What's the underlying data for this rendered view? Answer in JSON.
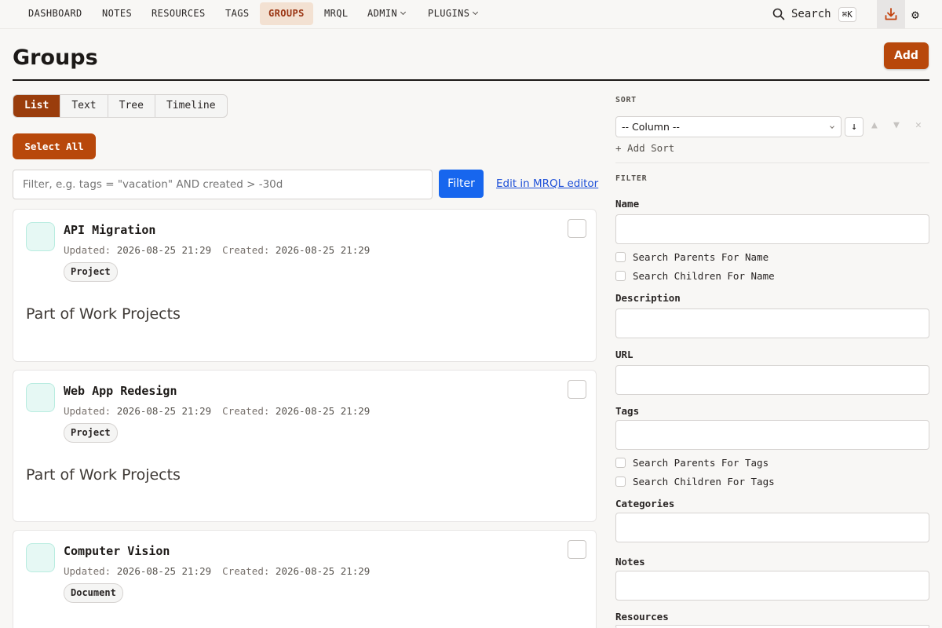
{
  "nav": {
    "items": [
      {
        "label": "DASHBOARD"
      },
      {
        "label": "NOTES"
      },
      {
        "label": "RESOURCES"
      },
      {
        "label": "TAGS"
      },
      {
        "label": "GROUPS",
        "active": true
      },
      {
        "label": "MRQL"
      },
      {
        "label": "ADMIN",
        "dropdown": true
      },
      {
        "label": "PLUGINS",
        "dropdown": true
      }
    ],
    "search_label": "Search",
    "search_shortcut": "⌘K"
  },
  "header": {
    "title": "Groups",
    "add_label": "Add"
  },
  "view_tabs": [
    {
      "label": "List",
      "active": true
    },
    {
      "label": "Text"
    },
    {
      "label": "Tree"
    },
    {
      "label": "Timeline"
    }
  ],
  "select_all_label": "Select All",
  "filter_bar": {
    "placeholder": "Filter, e.g. tags = \"vacation\" AND created > -30d",
    "button_label": "Filter",
    "mrql_link_label": "Edit in MRQL editor"
  },
  "groups": [
    {
      "name": "API Migration",
      "updated_label": "Updated:",
      "updated": "2026-08-25 21:29",
      "created_label": "Created:",
      "created": "2026-08-25 21:29",
      "tag": "Project",
      "description": "Part of Work Projects"
    },
    {
      "name": "Web App Redesign",
      "updated_label": "Updated:",
      "updated": "2026-08-25 21:29",
      "created_label": "Created:",
      "created": "2026-08-25 21:29",
      "tag": "Project",
      "description": "Part of Work Projects"
    },
    {
      "name": "Computer Vision",
      "updated_label": "Updated:",
      "updated": "2026-08-25 21:29",
      "created_label": "Created:",
      "created": "2026-08-25 21:29",
      "tag": "Document",
      "description": ""
    }
  ],
  "sidebar": {
    "sort_heading": "SORT",
    "sort_column": "-- Column --",
    "sort_direction": "↓",
    "add_sort_label": "+ Add Sort",
    "filter_heading": "FILTER",
    "fields": {
      "name": "Name",
      "search_parents_name": "Search Parents For Name",
      "search_children_name": "Search Children For Name",
      "description": "Description",
      "url": "URL",
      "tags": "Tags",
      "search_parents_tags": "Search Parents For Tags",
      "search_children_tags": "Search Children For Tags",
      "categories": "Categories",
      "notes": "Notes",
      "resources": "Resources"
    }
  },
  "colors": {
    "accent": "#b8480b",
    "accent_dark": "#9a3d0c",
    "primary_blue": "#1766ee",
    "active_nav_bg": "#f3e1d2"
  }
}
